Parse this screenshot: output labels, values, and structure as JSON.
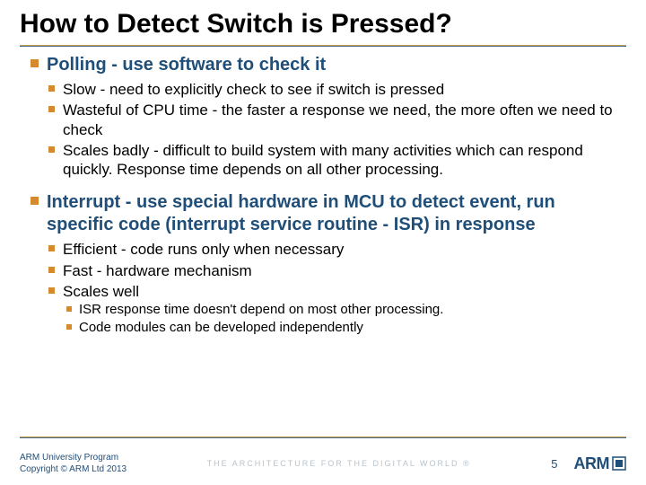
{
  "title": "How to Detect Switch is Pressed?",
  "sections": [
    {
      "heading": "Polling - use software to check it",
      "subs": [
        {
          "text": "Slow - need to explicitly check to see if switch is pressed",
          "subs": []
        },
        {
          "text": "Wasteful of CPU time - the faster a response we need, the more often we need to check",
          "subs": []
        },
        {
          "text": "Scales badly - difficult to build system with many activities which can respond quickly. Response time depends on all other processing.",
          "subs": []
        }
      ]
    },
    {
      "heading": "Interrupt - use special hardware in MCU to detect event, run specific code (interrupt service routine - ISR) in response",
      "subs": [
        {
          "text": "Efficient - code runs only when necessary",
          "subs": []
        },
        {
          "text": "Fast - hardware mechanism",
          "subs": []
        },
        {
          "text": "Scales well",
          "subs": [
            {
              "text": "ISR response time doesn't depend on most other processing."
            },
            {
              "text": "Code modules can be developed independently"
            }
          ]
        }
      ]
    }
  ],
  "footer": {
    "program": "ARM University Program",
    "copyright": "Copyright © ARM Ltd 2013",
    "tagline": "THE ARCHITECTURE FOR THE DIGITAL WORLD ®",
    "page": "5",
    "logo_text": "ARM"
  }
}
